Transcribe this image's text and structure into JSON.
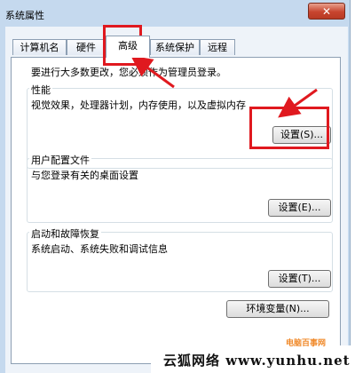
{
  "window": {
    "title": "系统属性",
    "close_glyph": "✕"
  },
  "tabs": [
    {
      "label": "计算机名"
    },
    {
      "label": "硬件"
    },
    {
      "label": "高级",
      "active": true
    },
    {
      "label": "系统保护"
    },
    {
      "label": "远程"
    }
  ],
  "notice": "要进行大多数更改，您必须作为管理员登录。",
  "performance": {
    "title": "性能",
    "description": "视觉效果，处理器计划，内存使用，以及虚拟内存",
    "settings_button": "设置(S)..."
  },
  "user_profiles": {
    "title": "用户配置文件",
    "description": "与您登录有关的桌面设置",
    "settings_button": "设置(E)..."
  },
  "startup_recovery": {
    "title": "启动和故障恢复",
    "description": "系统启动、系统失败和调试信息",
    "settings_button": "设置(T)..."
  },
  "env_button": "环境变量(N)...",
  "watermark": {
    "text": "云狐网络 www.yunhu.net",
    "logo_text": "电脑百事网"
  },
  "colors": {
    "annotation": "#e0191f",
    "window_frame": "#c5d9ee"
  }
}
